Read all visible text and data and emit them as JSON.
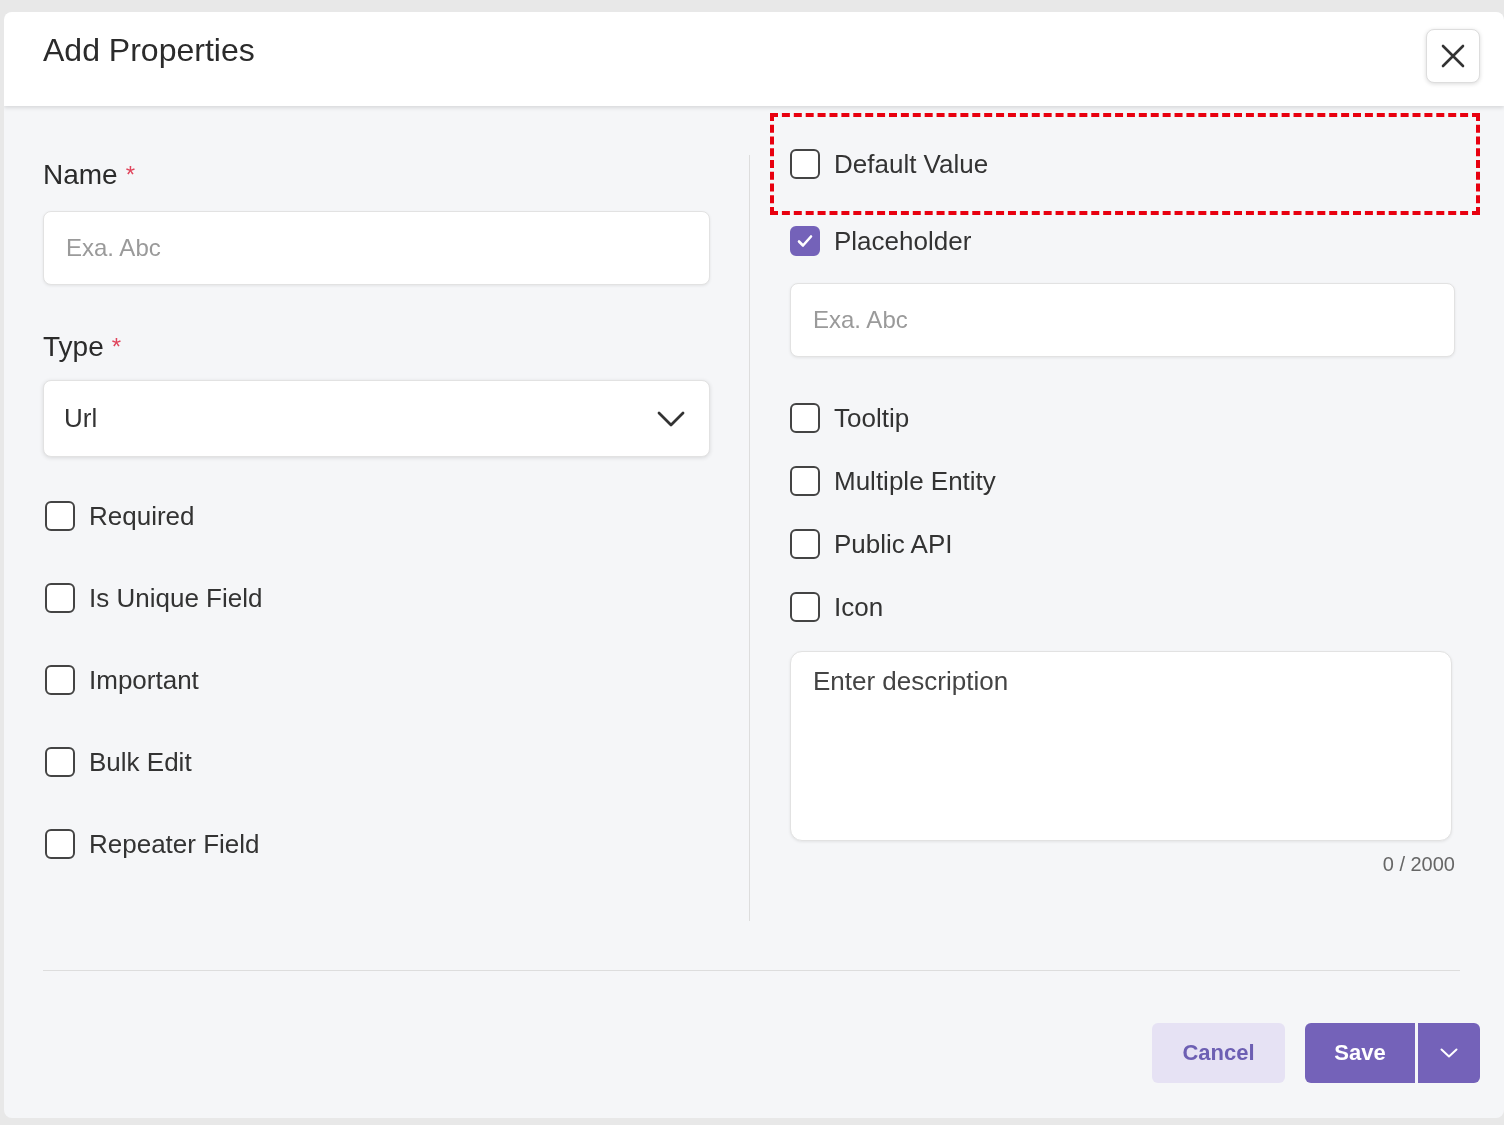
{
  "dialog": {
    "title": "Add Properties"
  },
  "left": {
    "fields": [
      {
        "kind": "input",
        "label": "Name",
        "required_mark": "*",
        "placeholder": "Exa. Abc"
      },
      {
        "kind": "select",
        "label": "Type",
        "required_mark": "*",
        "value": "Url"
      }
    ],
    "checkboxes": [
      {
        "label": "Required",
        "checked": false
      },
      {
        "label": "Is Unique Field",
        "checked": false
      },
      {
        "label": "Important",
        "checked": false
      },
      {
        "label": "Bulk Edit",
        "checked": false
      },
      {
        "label": "Repeater Field",
        "checked": false
      }
    ]
  },
  "right": {
    "items": [
      {
        "kind": "checkbox",
        "label": "Default Value",
        "checked": false,
        "highlighted": true
      },
      {
        "kind": "checkbox",
        "label": "Placeholder",
        "checked": true,
        "highlighted": false
      },
      {
        "kind": "input",
        "placeholder": "Exa. Abc"
      },
      {
        "kind": "checkbox",
        "label": "Tooltip",
        "checked": false,
        "highlighted": false
      },
      {
        "kind": "checkbox",
        "label": "Multiple Entity",
        "checked": false,
        "highlighted": false
      },
      {
        "kind": "checkbox",
        "label": "Public API",
        "checked": false,
        "highlighted": false
      },
      {
        "kind": "checkbox",
        "label": "Icon",
        "checked": false,
        "highlighted": false
      },
      {
        "kind": "textarea",
        "placeholder": "Enter description",
        "counter": "0 / 2000"
      }
    ]
  },
  "buttons": [
    {
      "kind": "secondary",
      "label": "Cancel"
    },
    {
      "kind": "primary",
      "label": "Save"
    }
  ]
}
